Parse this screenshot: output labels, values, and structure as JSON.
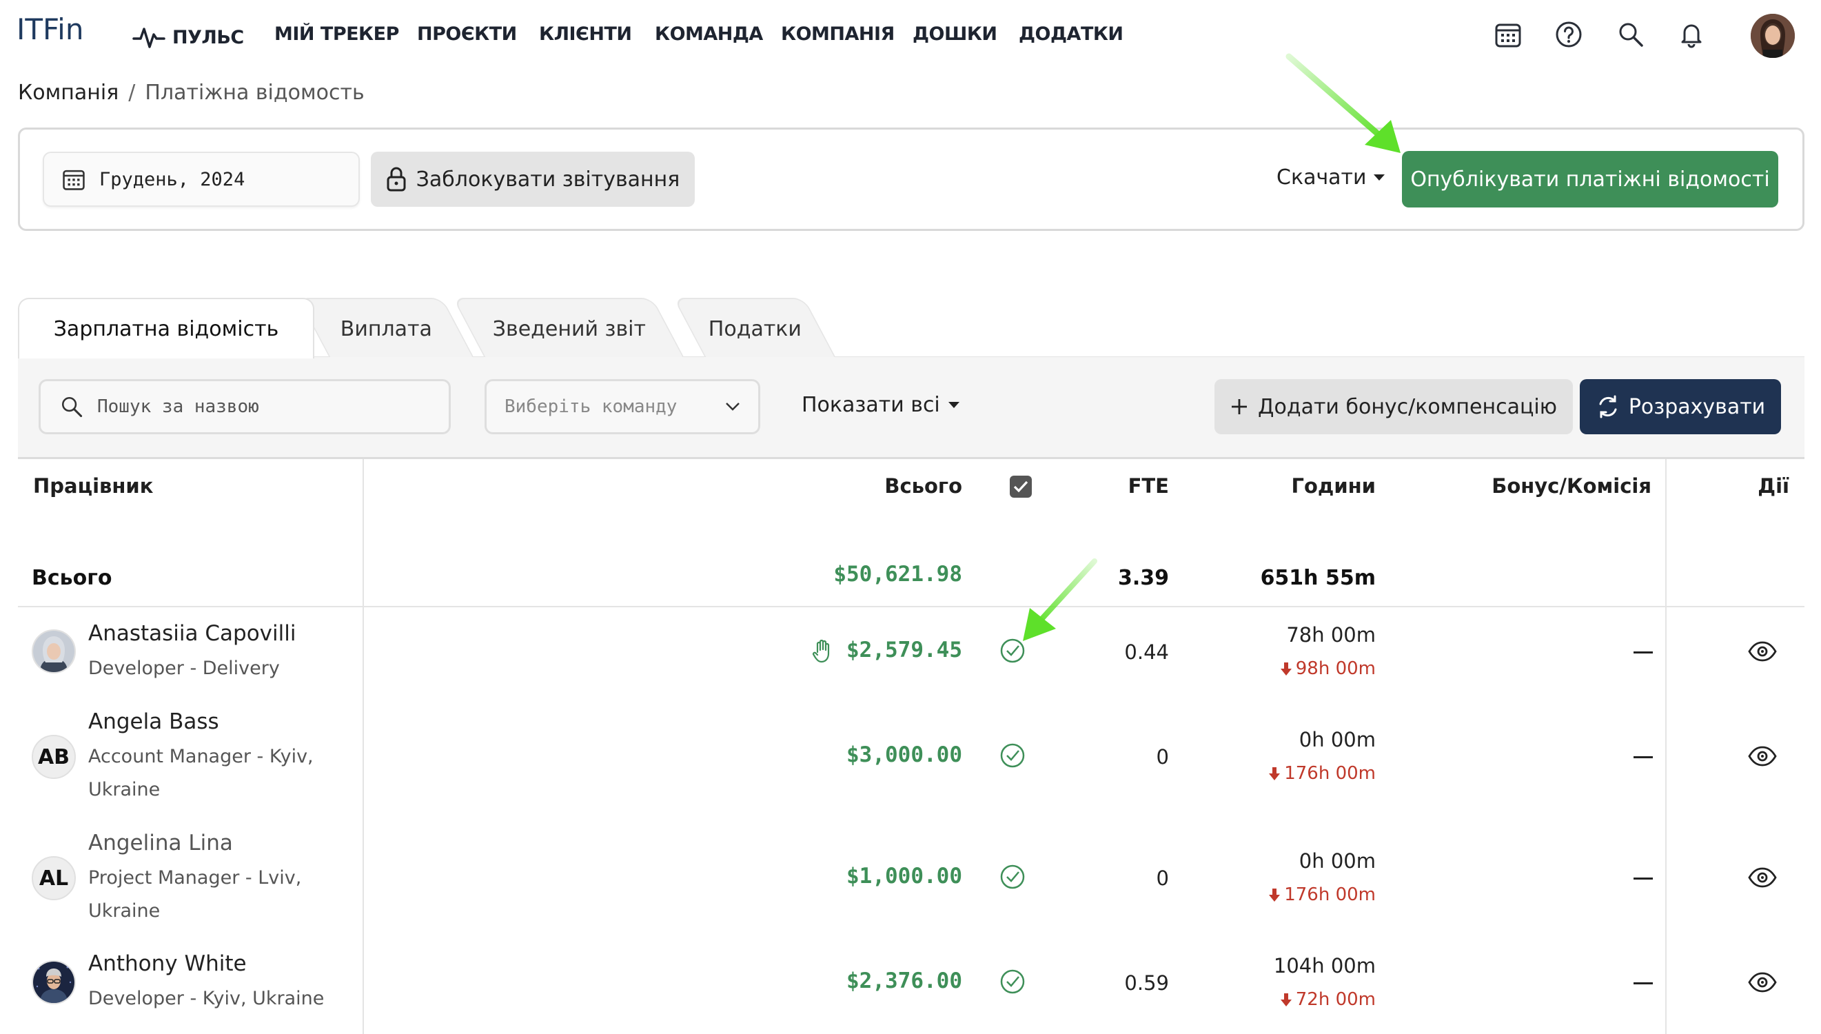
{
  "app": {
    "logo": "ITFin"
  },
  "nav": {
    "items": [
      {
        "label": "ПУЛЬС",
        "icon": "pulse-icon"
      },
      {
        "label": "МІЙ ТРЕКЕР"
      },
      {
        "label": "ПРОЄКТИ"
      },
      {
        "label": "КЛІЄНТИ"
      },
      {
        "label": "КОМАНДА"
      },
      {
        "label": "КОМПАНІЯ"
      },
      {
        "label": "ДОШКИ"
      },
      {
        "label": "ДОДАТКИ"
      }
    ],
    "icons": [
      "calendar-icon",
      "help-icon",
      "search-icon",
      "bell-icon"
    ]
  },
  "breadcrumb": {
    "parent": "Компанія",
    "separator": "/",
    "current": "Платіжна відомость"
  },
  "toolbar": {
    "period": "Грудень, 2024",
    "lock_label": "Заблокувати звітування",
    "download_label": "Скачати",
    "publish_label": "Опублікувати платіжні відомості"
  },
  "tabs": [
    {
      "label": "Зарплатна відомість",
      "active": true
    },
    {
      "label": "Виплата",
      "active": false
    },
    {
      "label": "Зведений звіт",
      "active": false
    },
    {
      "label": "Податки",
      "active": false
    }
  ],
  "filters": {
    "search_placeholder": "Пошук за назвою",
    "team_placeholder": "Виберіть команду",
    "show_label": "Показати всі",
    "bonus_label": "Додати бонус/компенсацію",
    "calculate_label": "Розрахувати"
  },
  "table": {
    "columns": {
      "employee": "Працівник",
      "total": "Всього",
      "fte": "FTE",
      "hours": "Години",
      "bonus": "Бонус/Комісія",
      "actions": "Дії"
    },
    "summary": {
      "label": "Всього",
      "total": "$50,621.98",
      "fte": "3.39",
      "hours": "651h 55m"
    },
    "rows": [
      {
        "name": "Anastasiia Capovilli",
        "role": "Developer - Delivery",
        "initials": "",
        "total": "$2,579.45",
        "fte": "0.44",
        "hours": "78h 00m",
        "diff": "98h 00m",
        "bonus": "—"
      },
      {
        "name": "Angela Bass",
        "role": "Account Manager - Kyiv, Ukraine",
        "initials": "AB",
        "total": "$3,000.00",
        "fte": "0",
        "hours": "0h 00m",
        "diff": "176h 00m",
        "bonus": "—"
      },
      {
        "name": "Angelina Lina",
        "role": "Project Manager - Lviv, Ukraine",
        "initials": "AL",
        "total": "$1,000.00",
        "fte": "0",
        "hours": "0h 00m",
        "diff": "176h 00m",
        "bonus": "—"
      },
      {
        "name": "Anthony White",
        "role": "Developer - Kyiv, Ukraine",
        "initials": "",
        "total": "$2,376.00",
        "fte": "0.59",
        "hours": "104h 00m",
        "diff": "72h 00m",
        "bonus": "—"
      }
    ]
  },
  "colors": {
    "brand": "#1f3a5f",
    "publish": "#3e8f58",
    "money": "#3e8f58",
    "calculate": "#1f3352",
    "negative": "#c0392b",
    "annotation_arrow": "#5ee02a"
  }
}
